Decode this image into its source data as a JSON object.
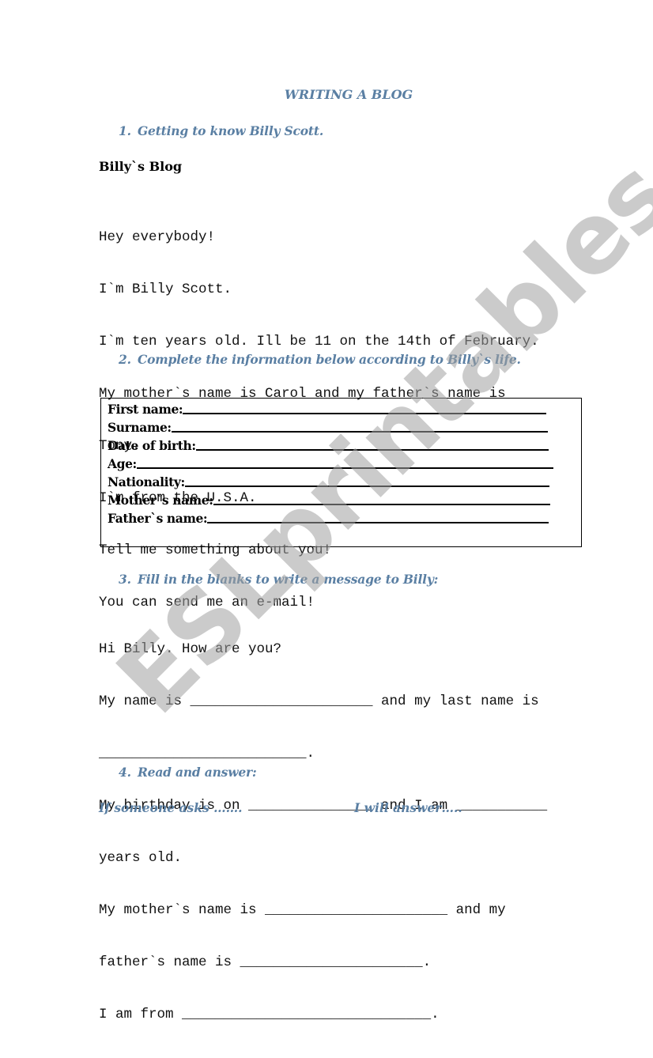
{
  "document": {
    "title": "WRITING A BLOG",
    "sections": [
      {
        "number": "1.",
        "heading": "Getting to know Billy Scott."
      },
      {
        "number": "2.",
        "heading": "Complete the information below according to Billy`s life."
      },
      {
        "number": "3.",
        "heading": "Fill in the blanks to write a message to Billy:"
      },
      {
        "number": "4.",
        "heading": "Read and answer:"
      }
    ],
    "blog": {
      "title": "Billy`s Blog",
      "lines": [
        "Hey everybody!",
        "I`m Billy Scott.",
        "I`m ten years old. Ill be 11 on the 14th of February.",
        "My mother`s name is Carol and my father`s name is",
        "Tony.",
        "I`m from the U.S.A.",
        "Tell me something about you!",
        "You can send me an e-mail!"
      ]
    },
    "info_form": {
      "fields": [
        {
          "label": "First name:",
          "value": ""
        },
        {
          "label": "Surname:",
          "value": ""
        },
        {
          "label": "Date of birth:",
          "value": ""
        },
        {
          "label": "Age:",
          "value": ""
        },
        {
          "label": "Nationality:",
          "value": ""
        },
        {
          "label": "Mother`s name:",
          "value": ""
        },
        {
          "label": "Father`s name:",
          "value": ""
        }
      ]
    },
    "message": {
      "lines": [
        "Hi Billy. How are you?",
        "My name is ______________________ and my last name is",
        "_________________________.",
        "My birthday is on _______________ and I am ___________",
        "years old.",
        "My mother`s name is ______________________ and my",
        "father`s name is ______________________.",
        "I am from ______________________________."
      ]
    },
    "answer_columns": {
      "left": "If someone asks …….",
      "right": "I will answer….."
    },
    "watermark": "ESLprintables.com"
  }
}
